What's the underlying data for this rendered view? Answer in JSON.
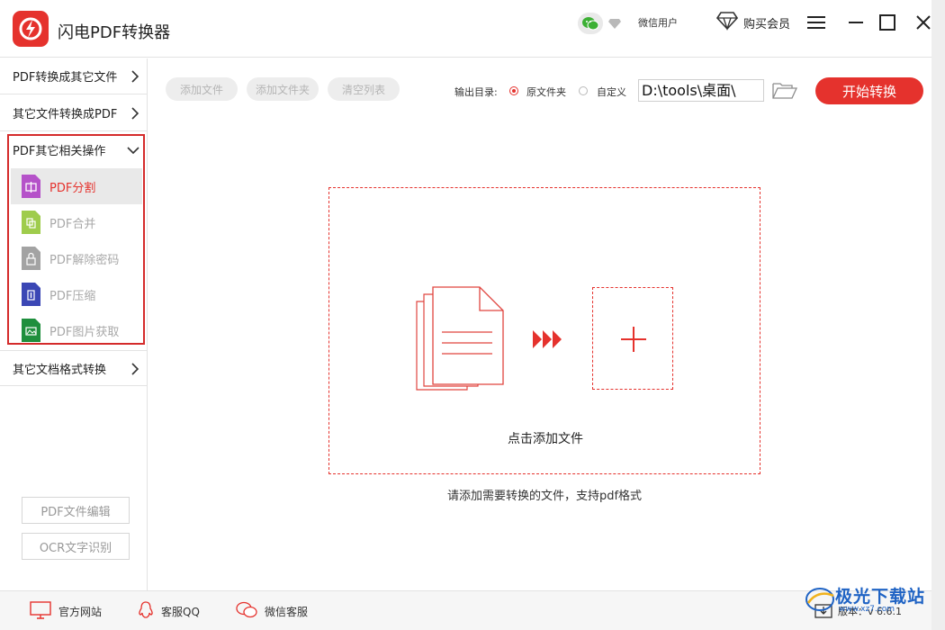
{
  "app": {
    "title": "闪电PDF转换器"
  },
  "titlebar": {
    "user_name": "微信用户",
    "buy_vip_label": "购买会员"
  },
  "sidebar": {
    "categories": [
      {
        "label": "PDF转换成其它文件"
      },
      {
        "label": "其它文件转换成PDF"
      },
      {
        "label": "PDF其它相关操作"
      },
      {
        "label": "其它文档格式转换"
      }
    ],
    "sub_items": [
      {
        "label": "PDF分割",
        "icon": "pdf-split-icon",
        "color": "#b552c9"
      },
      {
        "label": "PDF合并",
        "icon": "pdf-merge-icon",
        "color": "#9fcc4c"
      },
      {
        "label": "PDF解除密码",
        "icon": "pdf-unlock-icon",
        "color": "#a3a3a3"
      },
      {
        "label": "PDF压缩",
        "icon": "pdf-compress-icon",
        "color": "#3b47b5"
      },
      {
        "label": "PDF图片获取",
        "icon": "pdf-image-extract-icon",
        "color": "#1f8f3d"
      }
    ],
    "bottom_buttons": {
      "edit": "PDF文件编辑",
      "ocr": "OCR文字识别"
    }
  },
  "toolbar": {
    "add_file": "添加文件",
    "add_folder": "添加文件夹",
    "clear_list": "清空列表",
    "output_label": "输出目录:",
    "option_original": "原文件夹",
    "option_custom": "自定义",
    "output_path": "D:\\tools\\桌面\\",
    "start_label": "开始转换"
  },
  "dropzone": {
    "label": "点击添加文件",
    "hint": "请添加需要转换的文件，支持pdf格式"
  },
  "footer": {
    "website": "官方网站",
    "qq": "客服QQ",
    "wechat": "微信客服",
    "version": "版本：v 6.6.1"
  },
  "watermark": {
    "text": "极光下载站",
    "url": "www.xz7.com"
  },
  "colors": {
    "accent": "#e5322d",
    "highlight": "#d42b2b"
  }
}
